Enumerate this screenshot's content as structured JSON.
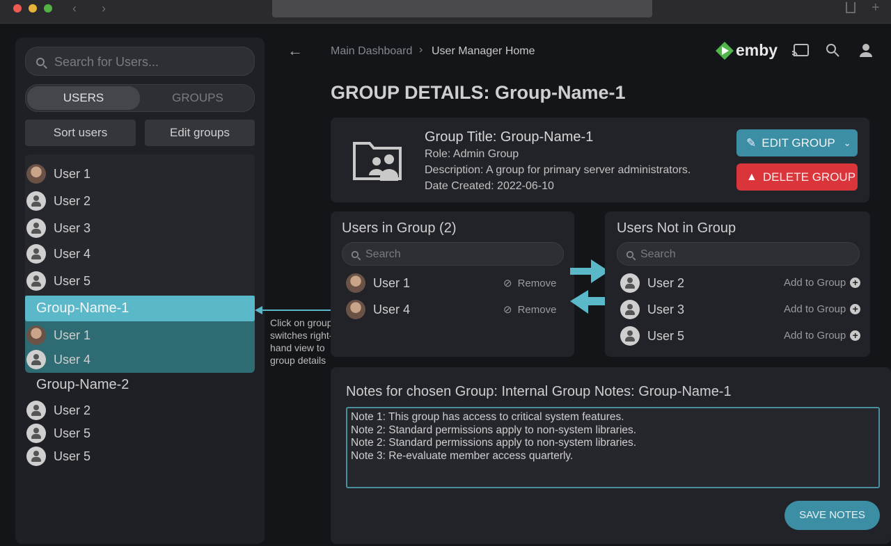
{
  "sidebar": {
    "search_placeholder": "Search for Users...",
    "tabs": [
      "USERS",
      "GROUPS"
    ],
    "sort_label": "Sort users",
    "edit_groups_label": "Edit groups",
    "users": [
      "User 1",
      "User 2",
      "User 3",
      "User 4",
      "User 5"
    ],
    "group1": {
      "name": "Group-Name-1",
      "members": [
        "User 1",
        "User 4"
      ]
    },
    "group2": {
      "name": "Group-Name-2",
      "members": [
        "User 2",
        "User 5",
        "User 5"
      ]
    }
  },
  "annotation": "Click on group switches right-hand view to group details",
  "header": {
    "breadcrumb": [
      "Main Dashboard",
      "User Manager Home"
    ],
    "brand": "emby"
  },
  "page_title": "GROUP DETAILS: Group-Name-1",
  "group_info": {
    "title": "Group Title: Group-Name-1",
    "role": "Role: Admin Group",
    "description": "Description: A group for primary server administrators.",
    "date": "Date Created: 2022-06-10",
    "edit_label": "EDIT GROUP",
    "delete_label": "DELETE GROUP"
  },
  "in_group": {
    "title": "Users in Group (2)",
    "search_placeholder": "Search",
    "users": [
      "User 1",
      "User 4"
    ],
    "action": "Remove"
  },
  "not_in_group": {
    "title": "Users Not in Group",
    "search_placeholder": "Search",
    "users": [
      "User 2",
      "User 3",
      "User 5"
    ],
    "action": "Add to Group"
  },
  "notes": {
    "title": "Notes for chosen Group: Internal Group Notes: Group-Name-1",
    "text": "Note 1: This group has access to critical system features.\nNote 2: Standard permissions apply to non-system libraries.\nNote 2: Standard permissions apply to non-system libraries.\nNote 3: Re-evaluate member access quarterly.",
    "save_label": "SAVE NOTES"
  },
  "colors": {
    "accent": "#4aa3b8",
    "danger": "#d9353a",
    "selected": "#5bb8c9"
  }
}
